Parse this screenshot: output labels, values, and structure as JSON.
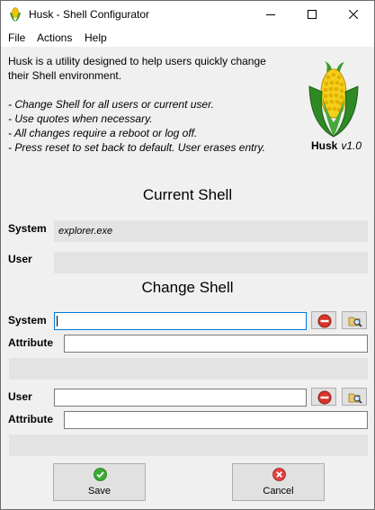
{
  "window": {
    "title": "Husk - Shell Configurator"
  },
  "menu": {
    "items": [
      "File",
      "Actions",
      "Help"
    ]
  },
  "intro": {
    "line1": "Husk is a utility designed to help users quickly change",
    "line2": "their Shell environment.",
    "bullets": [
      "- Change Shell for all users or current user.",
      "- Use quotes when necessary.",
      "- All changes require a reboot or log off.",
      "- Press reset to set back to default. User erases entry."
    ]
  },
  "logo": {
    "name": "Husk",
    "version": "v1.0",
    "icon": "corn-icon"
  },
  "current_shell": {
    "title": "Current Shell",
    "system_label": "System",
    "system_value": "explorer.exe",
    "user_label": "User",
    "user_value": ""
  },
  "change_shell": {
    "title": "Change Shell",
    "system_label": "System",
    "system_value": "",
    "system_attribute_label": "Attribute",
    "system_attribute_value": "",
    "user_label": "User",
    "user_value": "",
    "user_attribute_label": "Attribute",
    "user_attribute_value": ""
  },
  "buttons": {
    "save": "Save",
    "cancel": "Cancel"
  },
  "colors": {
    "accent": "#0078d7",
    "save": "#3aaa35",
    "cancel": "#e04343",
    "reset": "#d9342b"
  }
}
